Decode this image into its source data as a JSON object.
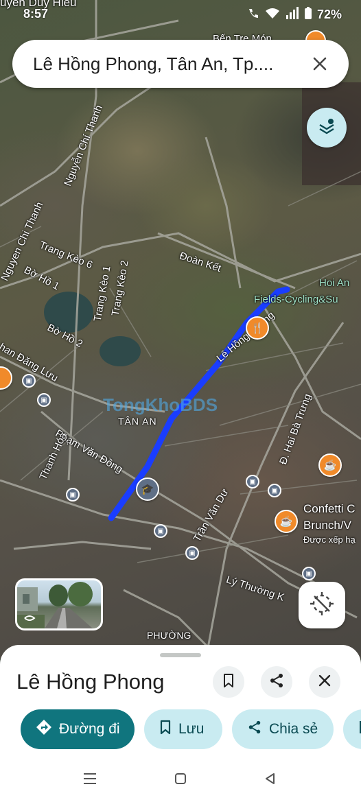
{
  "status_bar": {
    "time": "8:57",
    "top_label": "uyen Duy Hieu",
    "battery": "72%"
  },
  "search": {
    "query": "Lê Hồng Phong, Tân An, Tp...."
  },
  "map": {
    "labels": {
      "ben_tre_mon": "Bến Tre Món",
      "doan_ket": "Đoàn Kết",
      "hoi_an_fields_1": "Hoi An",
      "hoi_an_fields_2": "Fields-Cycling&Su",
      "nguyen_chi_thanh_a": "Nguyen Chi Thanh",
      "nguyen_chi_thanh_b": "Nguyễn Chí Thanh",
      "trang_keo_6": "Trang Kèo 6",
      "trang_keo_1": "Trang Kèo 1",
      "trang_keo_2": "Trang Kèo 2",
      "bo_ho_1": "Bờ Hồ 1",
      "bo_ho_2": "Bờ Hồ 2",
      "phan_dang_luu": "han Đăng Lưu",
      "le_hong_phong": "Lê Hồng Phong",
      "watermark": "TongKhoBDS",
      "tan_an": "TÂN AN",
      "pham_van_dong": "Phạm Văn Đồng",
      "thanh_hoa": "Thanh Hóa",
      "dai_hai_ba_trung": "Đ. Hai Bà Trưng",
      "confetti_1": "Confetti C",
      "confetti_2": "Brunch/V",
      "confetti_3": "Được xếp hạ",
      "tran_van_du": "Trần Văn Dư",
      "ly_thuong_kiet": "Lý Thường K",
      "phuong": "PHƯỜNG"
    },
    "route_color": "#1a3dff",
    "pin_color": "#f08a2a"
  },
  "sheet": {
    "title": "Lê Hồng Phong",
    "chips": {
      "directions": "Đường đi",
      "save": "Lưu",
      "share": "Chia sẻ"
    }
  },
  "colors": {
    "primary_chip": "#10757e",
    "secondary_chip": "#c9ebf1"
  }
}
